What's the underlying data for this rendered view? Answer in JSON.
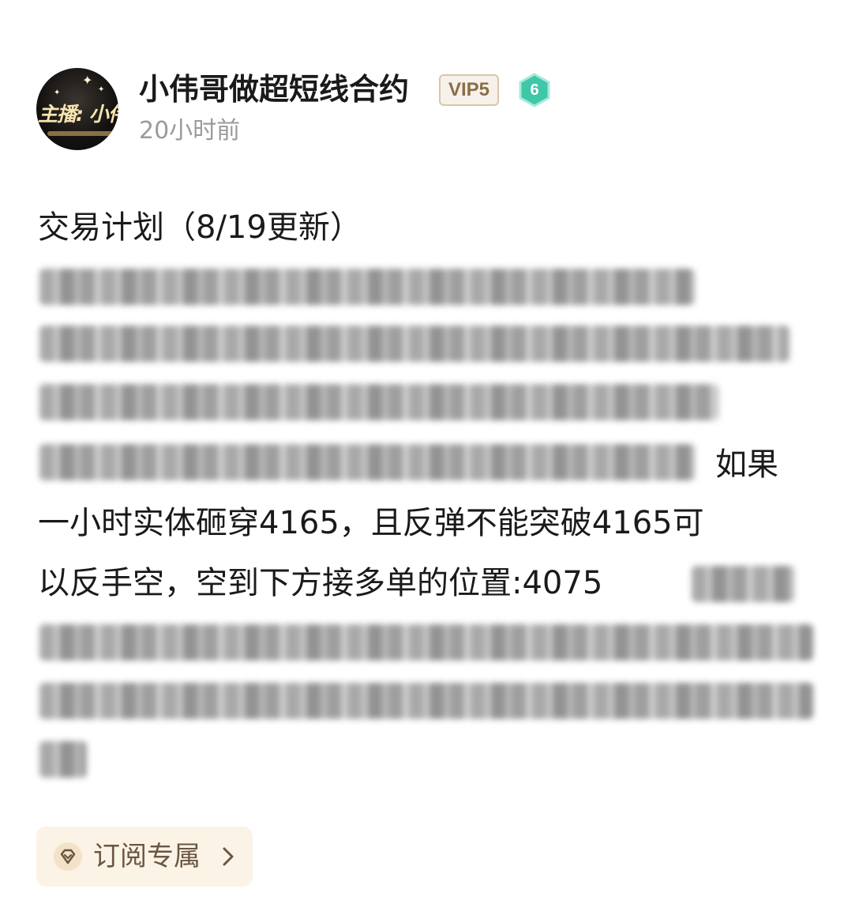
{
  "author": {
    "name": "小伟哥做超短线合约",
    "vip_badge": "VIP5",
    "level": "6",
    "timestamp": "20小时前",
    "avatar_text": "主播: 小伟哥"
  },
  "post": {
    "title": "交易计划（8/19更新）",
    "visible_fragments": {
      "line4_tail": "如果",
      "line5": "一小时实体砸穿4165，且反弹不能突破4165可",
      "line6": "以反手空，空到下方接多单的位置:4075"
    }
  },
  "subscribe": {
    "label": "订阅专属"
  },
  "colors": {
    "vip_text": "#8a6e48",
    "level_badge": "#3fc7a8",
    "chip_bg": "#fbf3e6",
    "timestamp": "#9a9a9a"
  },
  "icons": {
    "level": "hexagon-badge-icon",
    "subscribe": "diamond-icon",
    "arrow": "chevron-right-icon"
  }
}
